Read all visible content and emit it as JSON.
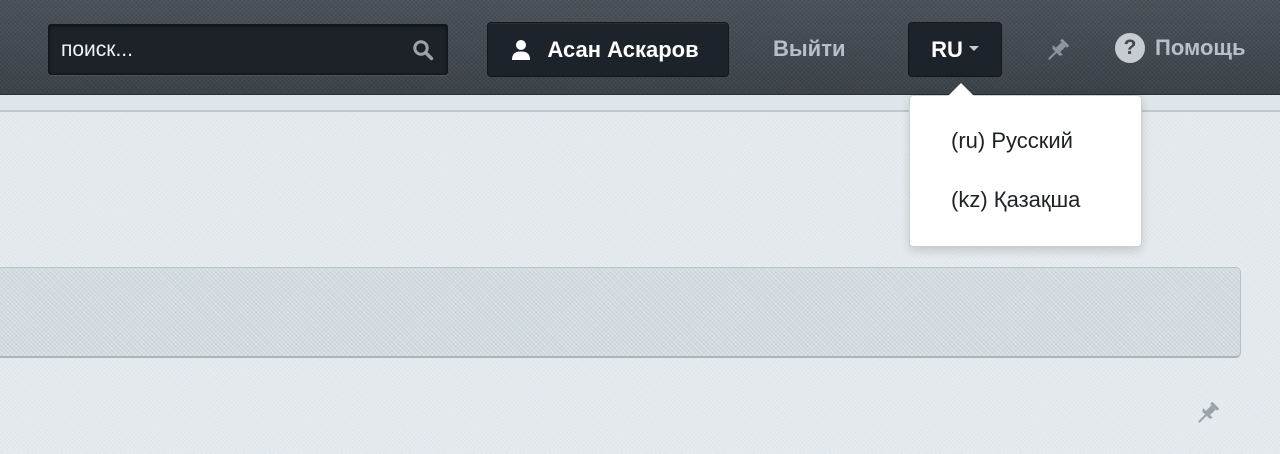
{
  "header": {
    "search": {
      "placeholder": "поиск..."
    },
    "user_button": {
      "label": "Асан Аскаров",
      "icon": "user-icon"
    },
    "logout": {
      "label": "Выйти"
    },
    "language_button": {
      "label": "RU",
      "icon": "caret-down-icon"
    },
    "pin": {
      "icon": "pushpin-icon"
    },
    "help": {
      "label": "Помощь",
      "icon_glyph": "?",
      "icon": "help-icon"
    }
  },
  "language_menu": {
    "items": [
      {
        "label": "(ru) Русский"
      },
      {
        "label": "(kz) Қазақша"
      }
    ]
  },
  "content": {
    "pin": {
      "icon": "pushpin-icon"
    }
  },
  "colors": {
    "topbar": "#424950",
    "button_bg": "#1d232a",
    "muted_text": "#b8bfc6",
    "page_bg": "#e3eaed",
    "panel_bg": "#d0dadf"
  }
}
